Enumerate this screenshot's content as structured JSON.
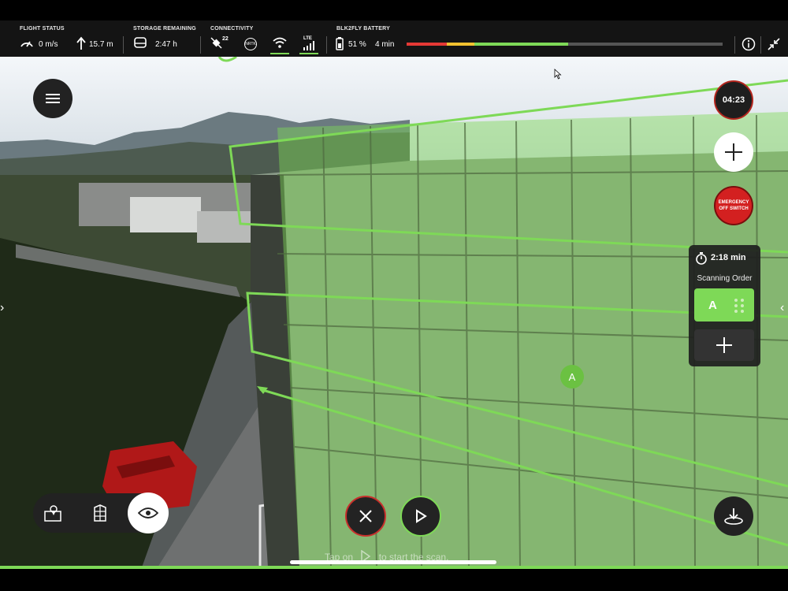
{
  "status_bar": {
    "flight_status": {
      "title": "FLIGHT STATUS",
      "speed": "0 m/s",
      "altitude": "15.7 m"
    },
    "storage": {
      "title": "STORAGE REMAINING",
      "value": "2:47 h"
    },
    "connectivity": {
      "title": "CONNECTIVITY",
      "satellites": "22",
      "nrtk": "NRTK",
      "lte": "LTE"
    },
    "battery": {
      "title": "BLK2FLY BATTERY",
      "percent": "51 %",
      "time": "4 min",
      "level": 0.51,
      "segment_colors": [
        "#e53935",
        "#f2c230",
        "#7ed957"
      ]
    }
  },
  "timer": "04:23",
  "emergency_button": {
    "line1": "EMERGENCY",
    "line2": "OFF SWITCH"
  },
  "scan_panel": {
    "duration": "2:18 min",
    "title": "Scanning Order",
    "item_label": "A"
  },
  "scan_marker": "A",
  "hint": {
    "before": "Tap on",
    "after": "to start the scan."
  },
  "colors": {
    "accent": "#7ed957",
    "danger": "#d32020",
    "panel": "#222222"
  },
  "icons": [
    "speedometer-icon",
    "altitude-arrow-icon",
    "storage-drive-icon",
    "satellite-icon",
    "nrtk-icon",
    "wifi-icon",
    "lte-signal-icon",
    "battery-icon",
    "info-icon",
    "collapse-icon",
    "menu-icon",
    "plus-icon",
    "stopwatch-icon",
    "drag-handle-icon",
    "map-pin-icon",
    "building-icon",
    "eye-icon",
    "close-icon",
    "play-icon",
    "land-icon"
  ]
}
